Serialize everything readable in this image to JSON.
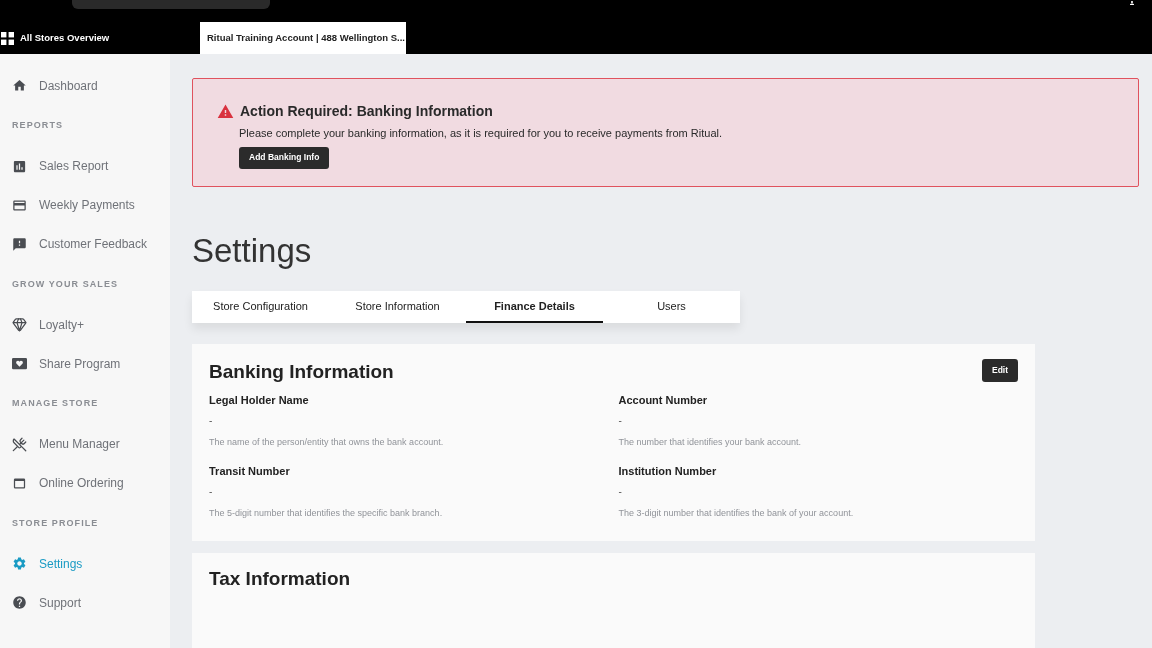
{
  "header": {
    "overview_link": "All Stores Overview",
    "store_tab": "Ritual Training Account | 488 Wellington S..."
  },
  "sidebar": {
    "items": [
      {
        "kind": "item",
        "label": "Dashboard",
        "selected": false
      },
      {
        "kind": "heading",
        "label": "REPORTS"
      },
      {
        "kind": "item",
        "label": "Sales Report",
        "selected": false
      },
      {
        "kind": "item",
        "label": "Weekly Payments",
        "selected": false
      },
      {
        "kind": "item",
        "label": "Customer Feedback",
        "selected": false
      },
      {
        "kind": "heading",
        "label": "GROW YOUR SALES"
      },
      {
        "kind": "item",
        "label": "Loyalty+",
        "selected": false
      },
      {
        "kind": "item",
        "label": "Share Program",
        "selected": false
      },
      {
        "kind": "heading",
        "label": "MANAGE STORE"
      },
      {
        "kind": "item",
        "label": "Menu Manager",
        "selected": false
      },
      {
        "kind": "item",
        "label": "Online Ordering",
        "selected": false
      },
      {
        "kind": "heading",
        "label": "STORE PROFILE"
      },
      {
        "kind": "item",
        "label": "Settings",
        "selected": true
      },
      {
        "kind": "item",
        "label": "Support",
        "selected": false
      }
    ]
  },
  "alert": {
    "title": "Action Required: Banking Information",
    "message": "Please complete your banking information, as it is required for you to receive payments from Ritual.",
    "button": "Add Banking Info"
  },
  "page_title": "Settings",
  "tabs": [
    {
      "label": "Store Configuration",
      "selected": false
    },
    {
      "label": "Store Information",
      "selected": false
    },
    {
      "label": "Finance Details",
      "selected": true
    },
    {
      "label": "Users",
      "selected": false
    }
  ],
  "banking": {
    "title": "Banking Information",
    "edit_button": "Edit",
    "fields": [
      {
        "label": "Legal Holder Name",
        "value": "-",
        "hint": "The name of the person/entity that owns the bank account."
      },
      {
        "label": "Account Number",
        "value": "-",
        "hint": "The number that identifies your bank account."
      },
      {
        "label": "Transit Number",
        "value": "-",
        "hint": "The 5-digit number that identifies the specific bank branch."
      },
      {
        "label": "Institution Number",
        "value": "-",
        "hint": "The 3-digit number that identifies the bank of your account."
      }
    ]
  },
  "tax": {
    "title": "Tax Information"
  }
}
